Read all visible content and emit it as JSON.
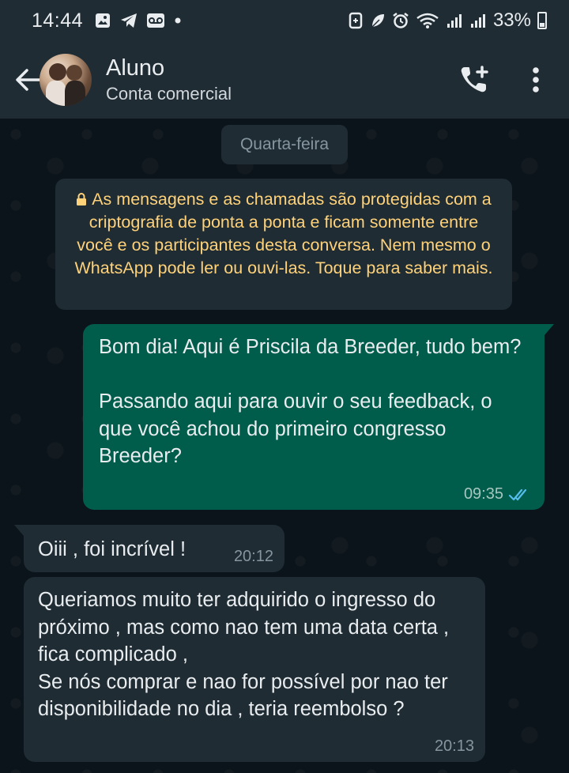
{
  "status_bar": {
    "time": "14:44",
    "battery": "33%",
    "left_icons": [
      "gallery-icon",
      "telegram-icon",
      "voicemail-icon",
      "dot-icon"
    ],
    "right_icons": [
      "data-saver-icon",
      "leaf-icon",
      "alarm-icon",
      "wifi-icon",
      "signal-icon",
      "signal-icon",
      "battery-icon"
    ]
  },
  "header": {
    "contact_name": "Aluno",
    "subtitle": "Conta comercial"
  },
  "chat": {
    "date_chip": "Quarta-feira",
    "encryption_notice": "As mensagens e as chamadas são protegidas com a criptografia de ponta a ponta e ficam somente entre você e os participantes desta conversa. Nem mesmo o WhatsApp pode ler ou ouvi-las. Toque para saber mais.",
    "messages": [
      {
        "direction": "outgoing",
        "text": "Bom dia! Aqui é Priscila da Breeder, tudo bem?\n\nPassando aqui para ouvir o seu feedback, o que você achou do primeiro congresso Breeder?",
        "time": "09:35",
        "status": "read"
      },
      {
        "direction": "incoming",
        "text": "Oiii , foi incrível !",
        "time": "20:12"
      },
      {
        "direction": "incoming",
        "text": "Queriamos muito ter adquirido o ingresso do próximo , mas como nao tem uma data certa , fica complicado ,\nSe nós comprar e nao for possível por nao ter disponibilidade no dia , teria reembolso ?",
        "time": "20:13"
      }
    ]
  },
  "colors": {
    "header_bg": "#1f2c34",
    "chat_bg": "#0b141a",
    "outgoing_bubble": "#005c4b",
    "incoming_bubble": "#1f2c34",
    "notice_text": "#ffd279",
    "read_ticks": "#53bdeb"
  }
}
